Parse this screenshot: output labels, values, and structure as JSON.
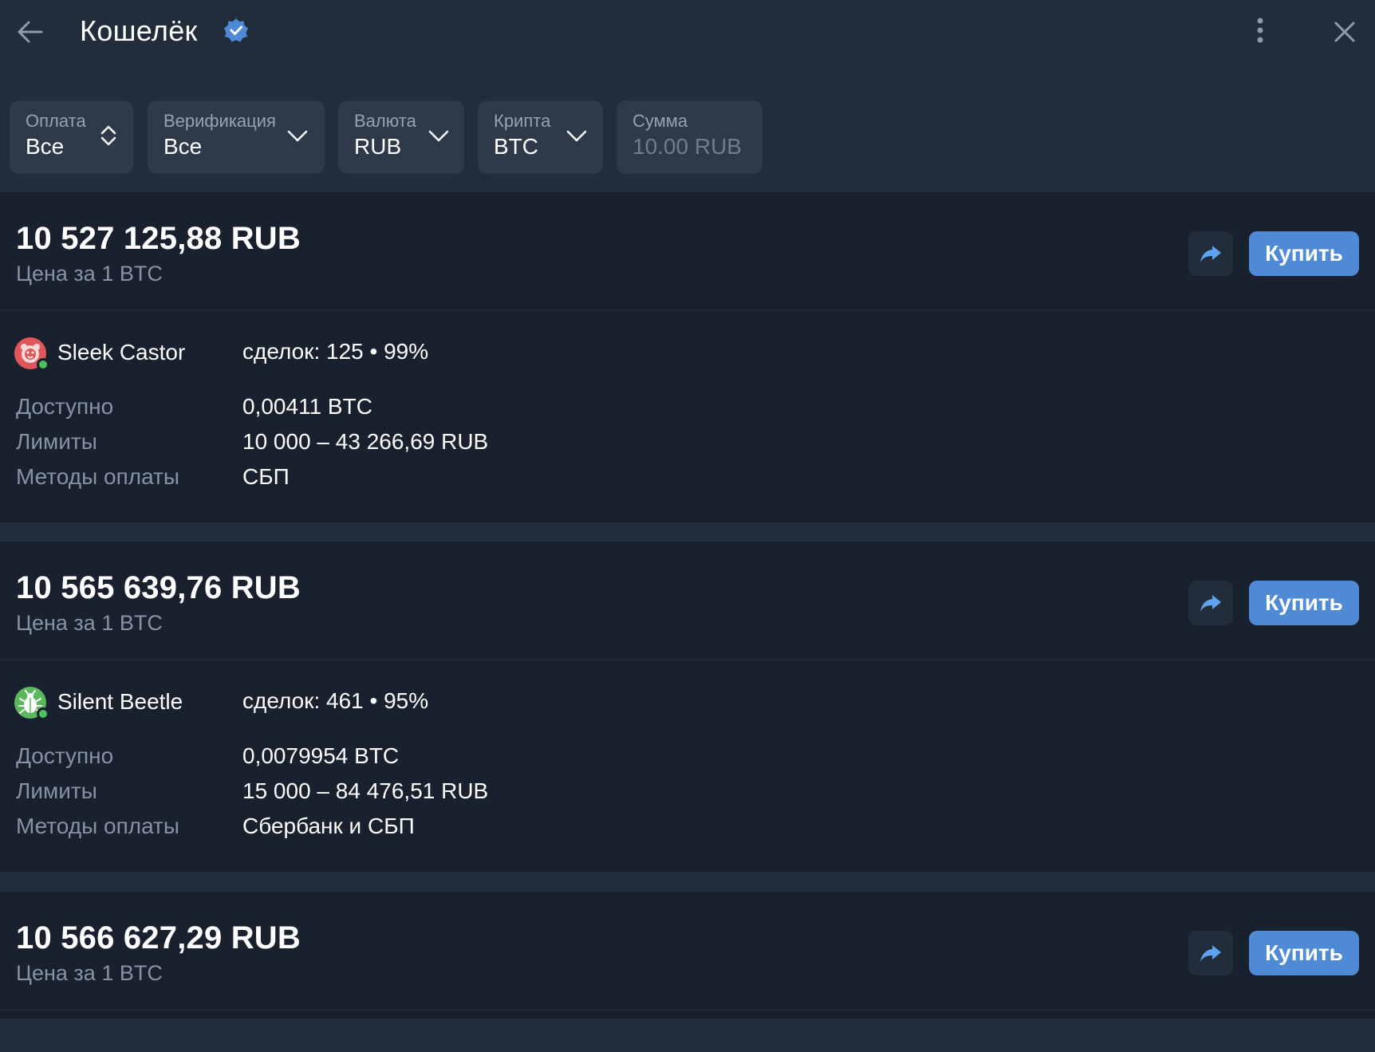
{
  "header": {
    "title": "Кошелёк",
    "icons": {
      "back": "arrow-left-icon",
      "verified": "verified-badge-icon",
      "more": "more-vertical-icon",
      "close": "close-icon"
    }
  },
  "filters": [
    {
      "label": "Оплата",
      "value": "Все",
      "chevron": "sort-updown"
    },
    {
      "label": "Верификация",
      "value": "Все",
      "chevron": "down"
    },
    {
      "label": "Валюта",
      "value": "RUB",
      "chevron": "down"
    },
    {
      "label": "Крипта",
      "value": "BTC",
      "chevron": "down"
    },
    {
      "label": "Сумма",
      "placeholder": "10.00 RUB"
    }
  ],
  "offers": [
    {
      "price": "10 527 125,88 RUB",
      "price_sub": "Цена за 1 BTC",
      "buy_label": "Купить",
      "seller": {
        "name": "Sleek Castor",
        "stats": "сделок: 125 • 99%",
        "avatar_color": "#e0565b",
        "avatar_icon": "bear-face-icon"
      },
      "rows": [
        {
          "label": "Доступно",
          "value": "0,00411 BTC"
        },
        {
          "label": "Лимиты",
          "value": "10 000 – 43 266,69 RUB"
        },
        {
          "label": "Методы оплаты",
          "value": "СБП"
        }
      ]
    },
    {
      "price": "10 565 639,76 RUB",
      "price_sub": "Цена за 1 BTC",
      "buy_label": "Купить",
      "seller": {
        "name": "Silent Beetle",
        "stats": "сделок: 461 • 95%",
        "avatar_color": "#5cb85c",
        "avatar_icon": "beetle-icon"
      },
      "rows": [
        {
          "label": "Доступно",
          "value": "0,0079954 BTC"
        },
        {
          "label": "Лимиты",
          "value": "15 000 – 84 476,51 RUB"
        },
        {
          "label": "Методы оплаты",
          "value": "Сбербанк и СБП"
        }
      ]
    },
    {
      "price": "10 566 627,29 RUB",
      "price_sub": "Цена за 1 BTC",
      "buy_label": "Купить"
    }
  ],
  "colors": {
    "accent": "#4f8bd4",
    "background": "#222d3b",
    "card": "#18212d",
    "online": "#4cc25b"
  }
}
